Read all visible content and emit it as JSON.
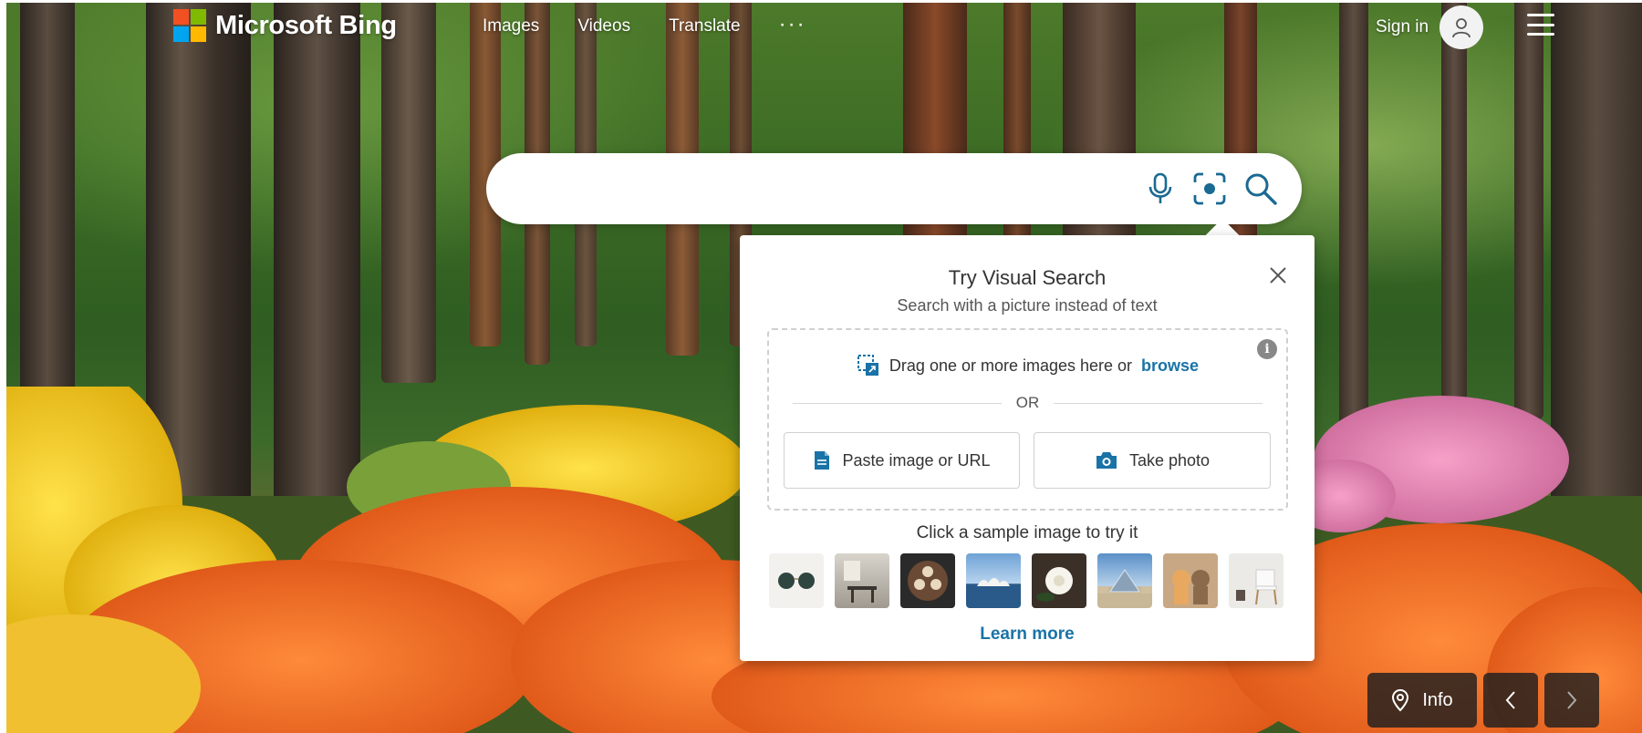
{
  "header": {
    "logo_text": "Microsoft Bing",
    "nav": [
      {
        "label": "Images"
      },
      {
        "label": "Videos"
      },
      {
        "label": "Translate"
      }
    ],
    "more_label": "···",
    "signin_label": "Sign in"
  },
  "search": {
    "value": "",
    "placeholder": ""
  },
  "visual_search": {
    "title": "Try Visual Search",
    "subtitle": "Search with a picture instead of text",
    "drag_text": "Drag one or more images here or",
    "browse_label": "browse",
    "or_label": "OR",
    "paste_label": "Paste image or URL",
    "photo_label": "Take photo",
    "sample_title": "Click a sample image to try it",
    "samples": [
      "sunglasses",
      "dining room",
      "coffee cups",
      "sydney opera house",
      "white flower",
      "pyramid museum",
      "cat and dog",
      "white chair"
    ],
    "learn_more_label": "Learn more",
    "info_glyph": "i"
  },
  "footer": {
    "info_label": "Info"
  },
  "colors": {
    "accent_link": "#1a73a7",
    "ms_red": "#f25022",
    "ms_green": "#7fba00",
    "ms_blue": "#00a4ef",
    "ms_yellow": "#ffb900"
  }
}
